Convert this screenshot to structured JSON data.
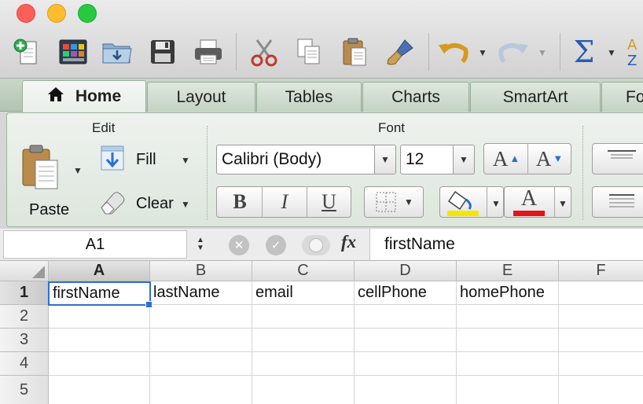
{
  "window": {
    "traffic_lights": [
      "close",
      "minimize",
      "zoom"
    ]
  },
  "toolbar": {
    "icons": [
      "new-workbook-icon",
      "templates-icon",
      "open-icon",
      "save-icon",
      "print-icon",
      "cut-icon",
      "copy-icon",
      "paste-icon",
      "format-painter-icon",
      "undo-icon",
      "redo-icon",
      "autosum-icon",
      "sort-icon"
    ]
  },
  "ribbon": {
    "tabs": [
      {
        "label": "Home",
        "active": true
      },
      {
        "label": "Layout"
      },
      {
        "label": "Tables"
      },
      {
        "label": "Charts"
      },
      {
        "label": "SmartArt"
      },
      {
        "label": "Fo"
      }
    ],
    "edit_group": {
      "title": "Edit",
      "paste_label": "Paste",
      "fill_label": "Fill",
      "clear_label": "Clear"
    },
    "font_group": {
      "title": "Font",
      "font_name": "Calibri (Body)",
      "font_size": "12",
      "grow_label": "A",
      "shrink_label": "A",
      "bold_label": "B",
      "italic_label": "I",
      "underline_label": "U",
      "font_color_label": "A",
      "highlight_color": "#f5e600",
      "font_color": "#e0161b"
    }
  },
  "formula_bar": {
    "name_box": "A1",
    "fx_label": "fx",
    "content": "firstName"
  },
  "sheet": {
    "columns": [
      "A",
      "B",
      "C",
      "D",
      "E",
      "F"
    ],
    "rows": [
      "1",
      "2",
      "3",
      "4",
      "5"
    ],
    "active_cell": "A1",
    "row1": [
      "firstName",
      "lastName",
      "email",
      "cellPhone",
      "homePhone",
      ""
    ]
  }
}
